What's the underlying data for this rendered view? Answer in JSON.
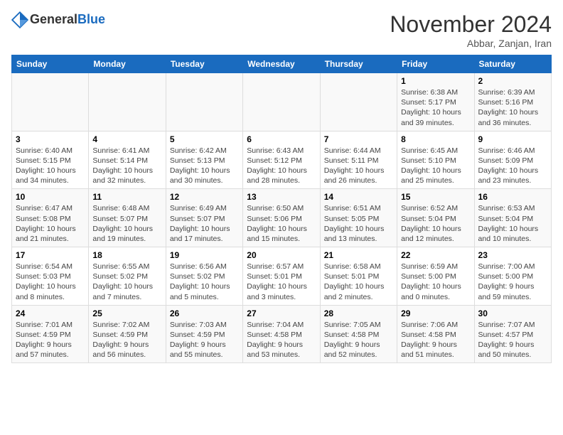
{
  "logo": {
    "line1": "General",
    "line2": "Blue"
  },
  "title": "November 2024",
  "subtitle": "Abbar, Zanjan, Iran",
  "headers": [
    "Sunday",
    "Monday",
    "Tuesday",
    "Wednesday",
    "Thursday",
    "Friday",
    "Saturday"
  ],
  "weeks": [
    [
      {
        "day": "",
        "info": ""
      },
      {
        "day": "",
        "info": ""
      },
      {
        "day": "",
        "info": ""
      },
      {
        "day": "",
        "info": ""
      },
      {
        "day": "",
        "info": ""
      },
      {
        "day": "1",
        "info": "Sunrise: 6:38 AM\nSunset: 5:17 PM\nDaylight: 10 hours and 39 minutes."
      },
      {
        "day": "2",
        "info": "Sunrise: 6:39 AM\nSunset: 5:16 PM\nDaylight: 10 hours and 36 minutes."
      }
    ],
    [
      {
        "day": "3",
        "info": "Sunrise: 6:40 AM\nSunset: 5:15 PM\nDaylight: 10 hours and 34 minutes."
      },
      {
        "day": "4",
        "info": "Sunrise: 6:41 AM\nSunset: 5:14 PM\nDaylight: 10 hours and 32 minutes."
      },
      {
        "day": "5",
        "info": "Sunrise: 6:42 AM\nSunset: 5:13 PM\nDaylight: 10 hours and 30 minutes."
      },
      {
        "day": "6",
        "info": "Sunrise: 6:43 AM\nSunset: 5:12 PM\nDaylight: 10 hours and 28 minutes."
      },
      {
        "day": "7",
        "info": "Sunrise: 6:44 AM\nSunset: 5:11 PM\nDaylight: 10 hours and 26 minutes."
      },
      {
        "day": "8",
        "info": "Sunrise: 6:45 AM\nSunset: 5:10 PM\nDaylight: 10 hours and 25 minutes."
      },
      {
        "day": "9",
        "info": "Sunrise: 6:46 AM\nSunset: 5:09 PM\nDaylight: 10 hours and 23 minutes."
      }
    ],
    [
      {
        "day": "10",
        "info": "Sunrise: 6:47 AM\nSunset: 5:08 PM\nDaylight: 10 hours and 21 minutes."
      },
      {
        "day": "11",
        "info": "Sunrise: 6:48 AM\nSunset: 5:07 PM\nDaylight: 10 hours and 19 minutes."
      },
      {
        "day": "12",
        "info": "Sunrise: 6:49 AM\nSunset: 5:07 PM\nDaylight: 10 hours and 17 minutes."
      },
      {
        "day": "13",
        "info": "Sunrise: 6:50 AM\nSunset: 5:06 PM\nDaylight: 10 hours and 15 minutes."
      },
      {
        "day": "14",
        "info": "Sunrise: 6:51 AM\nSunset: 5:05 PM\nDaylight: 10 hours and 13 minutes."
      },
      {
        "day": "15",
        "info": "Sunrise: 6:52 AM\nSunset: 5:04 PM\nDaylight: 10 hours and 12 minutes."
      },
      {
        "day": "16",
        "info": "Sunrise: 6:53 AM\nSunset: 5:04 PM\nDaylight: 10 hours and 10 minutes."
      }
    ],
    [
      {
        "day": "17",
        "info": "Sunrise: 6:54 AM\nSunset: 5:03 PM\nDaylight: 10 hours and 8 minutes."
      },
      {
        "day": "18",
        "info": "Sunrise: 6:55 AM\nSunset: 5:02 PM\nDaylight: 10 hours and 7 minutes."
      },
      {
        "day": "19",
        "info": "Sunrise: 6:56 AM\nSunset: 5:02 PM\nDaylight: 10 hours and 5 minutes."
      },
      {
        "day": "20",
        "info": "Sunrise: 6:57 AM\nSunset: 5:01 PM\nDaylight: 10 hours and 3 minutes."
      },
      {
        "day": "21",
        "info": "Sunrise: 6:58 AM\nSunset: 5:01 PM\nDaylight: 10 hours and 2 minutes."
      },
      {
        "day": "22",
        "info": "Sunrise: 6:59 AM\nSunset: 5:00 PM\nDaylight: 10 hours and 0 minutes."
      },
      {
        "day": "23",
        "info": "Sunrise: 7:00 AM\nSunset: 5:00 PM\nDaylight: 9 hours and 59 minutes."
      }
    ],
    [
      {
        "day": "24",
        "info": "Sunrise: 7:01 AM\nSunset: 4:59 PM\nDaylight: 9 hours and 57 minutes."
      },
      {
        "day": "25",
        "info": "Sunrise: 7:02 AM\nSunset: 4:59 PM\nDaylight: 9 hours and 56 minutes."
      },
      {
        "day": "26",
        "info": "Sunrise: 7:03 AM\nSunset: 4:59 PM\nDaylight: 9 hours and 55 minutes."
      },
      {
        "day": "27",
        "info": "Sunrise: 7:04 AM\nSunset: 4:58 PM\nDaylight: 9 hours and 53 minutes."
      },
      {
        "day": "28",
        "info": "Sunrise: 7:05 AM\nSunset: 4:58 PM\nDaylight: 9 hours and 52 minutes."
      },
      {
        "day": "29",
        "info": "Sunrise: 7:06 AM\nSunset: 4:58 PM\nDaylight: 9 hours and 51 minutes."
      },
      {
        "day": "30",
        "info": "Sunrise: 7:07 AM\nSunset: 4:57 PM\nDaylight: 9 hours and 50 minutes."
      }
    ]
  ]
}
